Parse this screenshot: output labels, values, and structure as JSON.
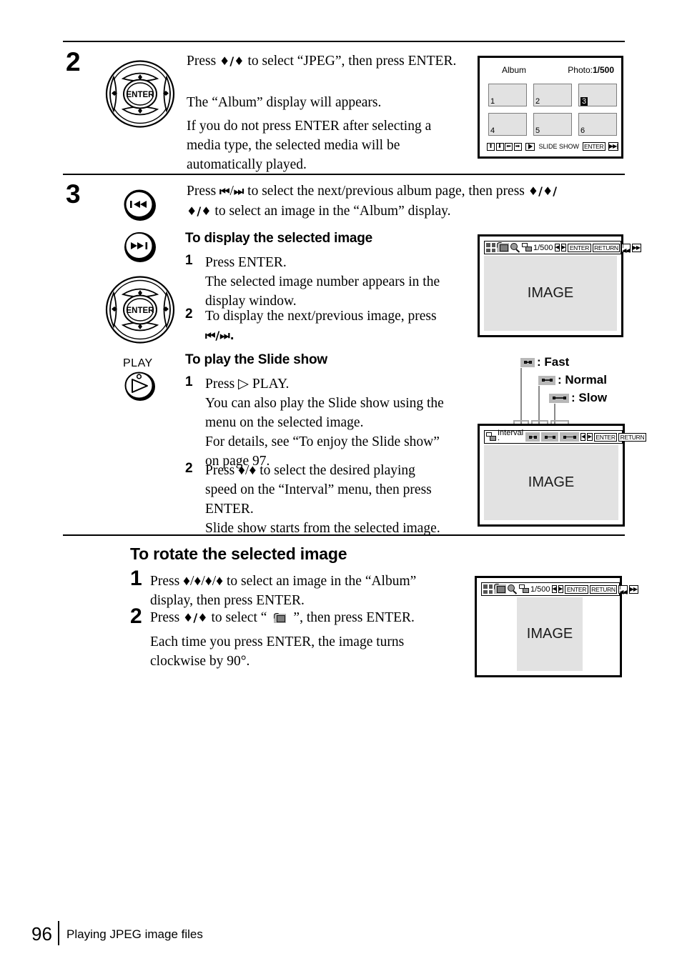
{
  "page": {
    "number": "96",
    "footer_title": "Playing JPEG image files"
  },
  "steps": [
    {
      "number": "2",
      "control_icon": "dpad-enter-icon",
      "control_label": "ENTER",
      "paragraphs": [
        "Press ♦/♦ to select “JPEG”, then press ENTER.",
        "The “Album” display will appears.",
        "If you do not press ENTER after selecting a media type, the selected media will be automatically played."
      ]
    },
    {
      "number": "3",
      "control_icons": [
        "prev-track-icon",
        "next-track-icon",
        "dpad-enter-icon",
        "play-icon"
      ],
      "play_label": "PLAY",
      "intro": "Press ⏮/⏭ to select the next/previous album page, then press ♦/♦/♦/♦ to select an image in the “Album” display."
    }
  ],
  "step2_text": {
    "line1_a": "Press ",
    "line1_arrows": "♦/♦",
    "line1_b": " to select “JPEG”, then press ENTER.",
    "para2": "The “Album” display will appears.",
    "para3": "If you do not press ENTER after selecting a media type, the selected media will be automatically played."
  },
  "step3_text": {
    "a": "Press ",
    "prev": "⏮",
    "slash1": "/",
    "next": "⏭",
    "b": " to select the next/previous album page, then press ",
    "arrows1": "♦/♦/",
    "arrows2": "♦/♦",
    "c": " to select an image in the “Album” display."
  },
  "display_section": {
    "heading": "To display the selected image",
    "items": [
      {
        "num": "1",
        "lines": [
          "Press ENTER.",
          "The selected image number appears in the",
          "display window."
        ]
      },
      {
        "num": "2",
        "lines": [
          "To display the next/previous image, press",
          "⏮/⏭."
        ]
      }
    ]
  },
  "slideshow_section": {
    "heading": "To play the Slide show",
    "items": [
      {
        "num": "1",
        "lines": [
          "Press ▷ PLAY.",
          "You can also play the Slide show using the",
          "menu on the selected image.",
          "For details, see “To enjoy the Slide show”",
          "on page 97."
        ]
      },
      {
        "num": "2",
        "lines": [
          "Press ♦/♦ to select the desired playing",
          "speed on the “Interval” menu, then press",
          "ENTER.",
          "Slide show starts from the selected image."
        ]
      }
    ]
  },
  "rotate_section": {
    "heading": "To rotate the selected image",
    "items": [
      {
        "num": "1",
        "lines": [
          "Press ♦/♦/♦/♦ to select an image in the “Album”",
          "display, then press ENTER."
        ]
      },
      {
        "num": "2",
        "lines": [
          "Press ♦/♦ to select “      ”, then press ENTER.",
          "Each time you press ENTER, the image turns",
          "clockwise by 90°."
        ]
      }
    ],
    "line2_pre": "Press ",
    "line2_arrows": "♦/♦",
    "line2_mid": " to select “",
    "line2_post": "”, then press ENTER.",
    "line3": "Each time you press ENTER, the image turns",
    "line4": "clockwise by 90°."
  },
  "album_screen": {
    "name": "Album",
    "title": "Album",
    "photo_label": "Photo:",
    "photo_count": "1/500",
    "thumbnails": [
      {
        "label": "1",
        "selected": false
      },
      {
        "label": "2",
        "selected": false
      },
      {
        "label": "3",
        "selected": true
      },
      {
        "label": "4",
        "selected": false
      },
      {
        "label": "5",
        "selected": false
      },
      {
        "label": "6",
        "selected": false
      }
    ],
    "bottom_bar": {
      "arrows": [
        "⬆",
        "⬇",
        "⬅",
        "➡"
      ],
      "play_icon": "play-icon",
      "slide_show_label": "SLIDE SHOW",
      "enter_label": "ENTER",
      "next_label": "▶▶|"
    }
  },
  "image_screen": {
    "icons": [
      "album-grid-icon",
      "rotate-icon",
      "zoom-icon",
      "multi-image-icon"
    ],
    "counter": "1/500",
    "arrow_left": "◀",
    "arrow_right": "▶",
    "enter_label": "ENTER",
    "return_label": "RETURN",
    "prev_label": "|◀◀",
    "next_label": "▶▶|",
    "image_label": "IMAGE"
  },
  "interval_screen": {
    "stack_icon": "multi-image-icon",
    "title": "Interval :",
    "speeds": [
      "fast",
      "normal",
      "slow"
    ],
    "arrow_left": "◀",
    "arrow_right": "▶",
    "enter_label": "ENTER",
    "return_label": "RETURN",
    "image_label": "IMAGE"
  },
  "speed_callouts": [
    {
      "icon": "speed-fast-icon",
      "label": ": Fast"
    },
    {
      "icon": "speed-normal-icon",
      "label": ": Normal"
    },
    {
      "icon": "speed-slow-icon",
      "label": ": Slow"
    }
  ],
  "rotate_screen": {
    "icons": [
      "album-grid-icon",
      "rotate-icon",
      "zoom-icon",
      "multi-image-icon"
    ],
    "counter": "1/500",
    "arrow_left": "◀",
    "arrow_right": "▶",
    "enter_label": "ENTER",
    "return_label": "RETURN",
    "prev_label": "|◀◀",
    "next_label": "▶▶|",
    "image_label": "IMAGE"
  },
  "colors": {
    "ink": "#000000",
    "screen_gray": "#e2e2e2",
    "swatch_gray": "#b8b8b8",
    "leader_gray": "#8a8a8a"
  }
}
